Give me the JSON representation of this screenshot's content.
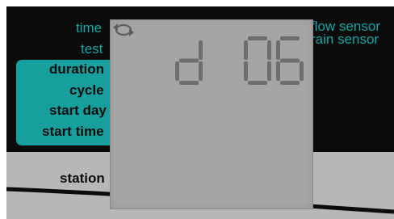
{
  "labels": {
    "time": "time",
    "test": "test",
    "flow_sensor": "flow sensor",
    "rain_sensor": "rain sensor",
    "duration": "duration",
    "cycle": "cycle",
    "start_day": "start day",
    "start_time": "start time",
    "station": "station"
  },
  "display": {
    "text": "d 06",
    "characters": [
      "d",
      " ",
      "0",
      "6"
    ],
    "indicator_icon": "cycle-icon"
  },
  "colors": {
    "teal": "#10a7a4",
    "teal_box": "#169f9c",
    "lcd_background": "#a5a5a5",
    "segment": "#6e6e6e",
    "panel": "#0b0b0b",
    "lower_panel": "#b7b7b7"
  }
}
